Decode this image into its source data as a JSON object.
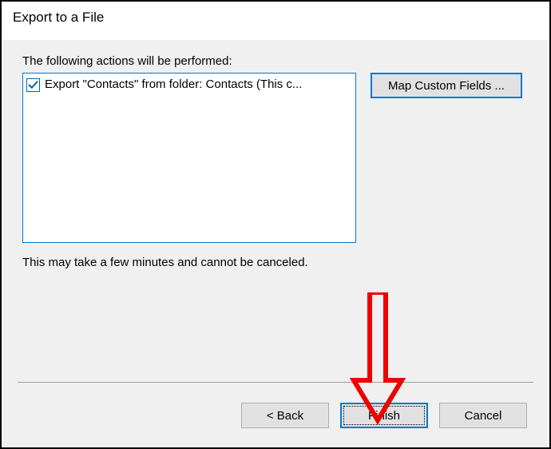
{
  "dialog": {
    "title": "Export to a File"
  },
  "content": {
    "actions_label": "The following actions will be performed:",
    "note": "This may take a few minutes and cannot be canceled."
  },
  "list": {
    "item0": {
      "checked": true,
      "text": "Export \"Contacts\" from folder: Contacts (This c..."
    }
  },
  "sidebar": {
    "map_fields_label": "Map Custom Fields ..."
  },
  "buttons": {
    "back": "< Back",
    "finish": "Finish",
    "cancel": "Cancel"
  }
}
